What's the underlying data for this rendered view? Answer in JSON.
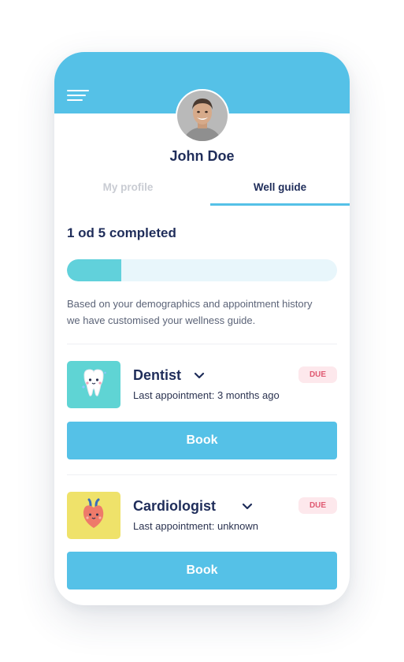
{
  "header": {
    "menu_icon": "hamburger-menu-icon",
    "color": "#55c1e7"
  },
  "profile": {
    "name": "John Doe",
    "avatar": "user-avatar"
  },
  "tabs": [
    {
      "label": "My profile",
      "active": false
    },
    {
      "label": "Well guide",
      "active": true
    }
  ],
  "progress": {
    "title": "1 od 5 completed",
    "fraction": 0.2,
    "fill_color": "#61d1db",
    "track_color": "#e8f6fb"
  },
  "description": "Based on your demographics and appointment history we have customised your wellness guide.",
  "guide_items": [
    {
      "title": "Dentist",
      "subtitle": "Last appointment: 3 months ago",
      "badge": "DUE",
      "icon": "tooth-icon",
      "icon_bg": "#5fd4d4",
      "button_label": "Book"
    },
    {
      "title": "Cardiologist",
      "subtitle": "Last appointment: unknown",
      "badge": "DUE",
      "icon": "heart-icon",
      "icon_bg": "#efe26a",
      "button_label": "Book"
    }
  ]
}
